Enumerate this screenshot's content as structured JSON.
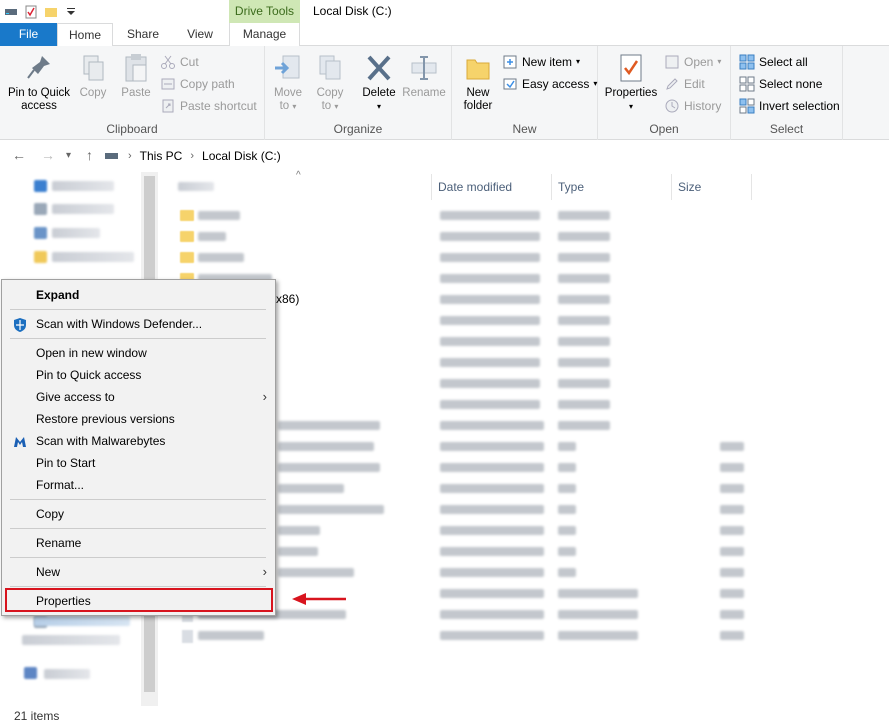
{
  "window": {
    "title": "Local Disk (C:)",
    "contextual_tab_group": "Drive Tools"
  },
  "tabs": {
    "file": "File",
    "home": "Home",
    "share": "Share",
    "view": "View",
    "manage": "Manage"
  },
  "ribbon": {
    "clipboard": {
      "label": "Clipboard",
      "pin": "Pin to Quick access",
      "copy": "Copy",
      "paste": "Paste",
      "cut": "Cut",
      "copy_path": "Copy path",
      "paste_shortcut": "Paste shortcut"
    },
    "organize": {
      "label": "Organize",
      "move_to": "Move to",
      "copy_to": "Copy to",
      "delete": "Delete",
      "rename": "Rename"
    },
    "new": {
      "label": "New",
      "new_folder": "New folder",
      "new_item": "New item",
      "easy_access": "Easy access"
    },
    "open": {
      "label": "Open",
      "properties": "Properties",
      "open": "Open",
      "edit": "Edit",
      "history": "History"
    },
    "select": {
      "label": "Select",
      "select_all": "Select all",
      "select_none": "Select none",
      "invert": "Invert selection"
    }
  },
  "address": {
    "crumbs": [
      "This PC",
      "Local Disk (C:)"
    ]
  },
  "columns": {
    "name": "Name",
    "date_modified": "Date modified",
    "type": "Type",
    "size": "Size"
  },
  "file_list": {
    "visible_fragment": "x86)"
  },
  "status": {
    "item_count": "21 items"
  },
  "context_menu": {
    "items": [
      "Expand",
      "Scan with Windows Defender...",
      "Open in new window",
      "Pin to Quick access",
      "Give access to",
      "Restore previous versions",
      "Scan with Malwarebytes",
      "Pin to Start",
      "Format...",
      "Copy",
      "Rename",
      "New",
      "Properties"
    ]
  },
  "colors": {
    "accent": "#1979ca",
    "drive_tools": "#cfe7b5",
    "highlight": "#d8141e"
  }
}
